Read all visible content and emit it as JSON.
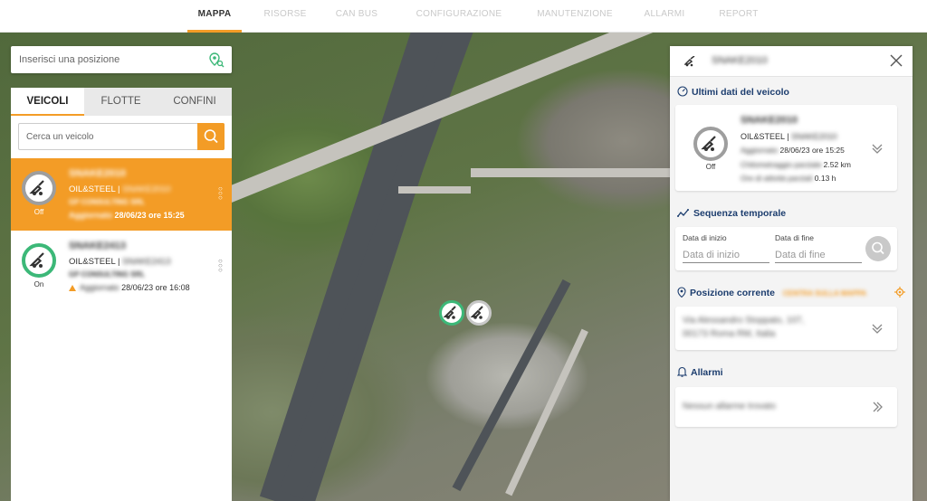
{
  "nav": {
    "tabs": [
      {
        "label": "MAPPA",
        "active": true
      },
      {
        "label": "RISORSE"
      },
      {
        "label": "CAN BUS"
      },
      {
        "label": "CONFIGURAZIONE"
      },
      {
        "label": "MANUTENZIONE"
      },
      {
        "label": "ALLARMI"
      },
      {
        "label": "REPORT"
      }
    ]
  },
  "position_search": {
    "placeholder": "Inserisci una posizione",
    "icon": "map-pin-search-icon"
  },
  "left": {
    "tabs": [
      {
        "label": "VEICOLI",
        "active": true
      },
      {
        "label": "FLOTTE"
      },
      {
        "label": "CONFINI"
      }
    ],
    "search": {
      "placeholder": "Cerca un veicolo",
      "icon": "search-icon"
    },
    "vehicles": [
      {
        "name": "SNAKE2010",
        "status": "Off",
        "owner": "OIL&STEEL |",
        "owner_blur": "SNAKE2010",
        "company": "GP CONSULTING SRL",
        "last_label": "Aggiornato",
        "last_date": "28/06/23 ore 15:25",
        "selected": true
      },
      {
        "name": "SNAKE2413",
        "status": "On",
        "owner": "OIL&STEEL |",
        "owner_blur": "SNAKE2413",
        "company": "GP CONSULTING SRL",
        "last_label": "Aggiornato",
        "last_date": "28/06/23 ore 16:08",
        "warning": true
      }
    ]
  },
  "right": {
    "title": "SNAKE2010",
    "sections": {
      "last_data": {
        "title": "Ultimi dati del veicolo",
        "name": "SNAKE2010",
        "status": "Off",
        "owner": "OIL&STEEL |",
        "owner_blur": "SNAKE2010",
        "updated_label": "Aggiornato",
        "updated": "28/06/23 ore 15:25",
        "km_label": "Chilometraggio parziale",
        "km": "2.52 km",
        "hours_label": "Ore di attività parziali",
        "hours": "0.13 h"
      },
      "timeline": {
        "title": "Sequenza temporale",
        "start_label": "Data di inizio",
        "start_placeholder": "Data di inizio",
        "end_label": "Data di fine",
        "end_placeholder": "Data di fine"
      },
      "position": {
        "title": "Posizione corrente",
        "link": "CENTRA SULLA MAPPA",
        "address_line1": "Via Alessandro Stoppato, 107,",
        "address_line2": "00173 Roma RM, Italia"
      },
      "alarms": {
        "title": "Allarmi",
        "empty": "Nessun allarme trovato"
      }
    }
  },
  "colors": {
    "accent": "#f39c26",
    "on": "#3cb878",
    "off": "#9e9e9e",
    "heading": "#1c3d6e"
  }
}
